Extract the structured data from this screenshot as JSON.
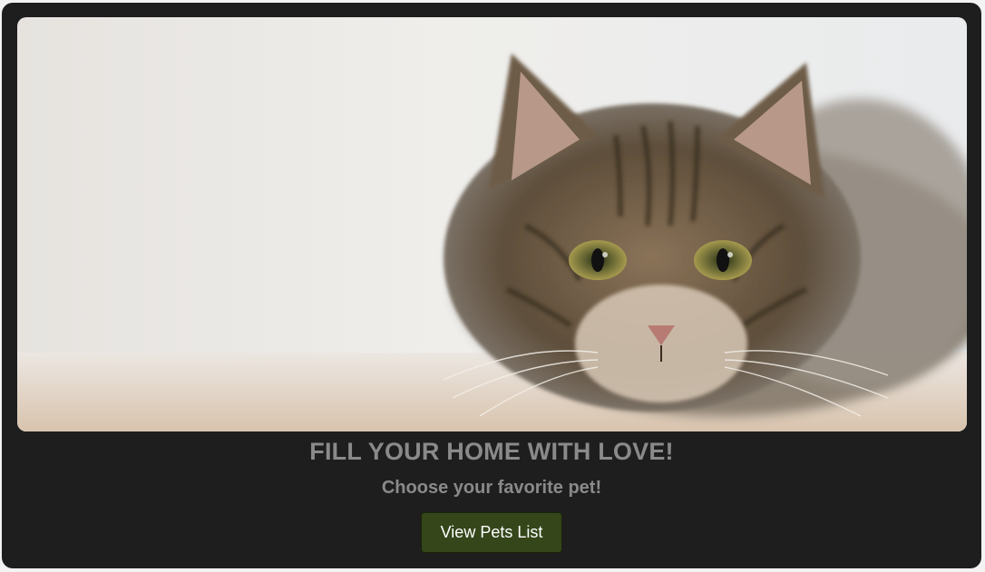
{
  "hero": {
    "image_subject": "tabby-cat-photo"
  },
  "headline": "FILL YOUR HOME WITH LOVE!",
  "subline": "Choose your favorite pet!",
  "cta_label": "View Pets List",
  "colors": {
    "card_background": "#1e1e1e",
    "text_muted": "#8a8a8a",
    "button_background": "#34461a",
    "button_text": "#ffffff"
  }
}
